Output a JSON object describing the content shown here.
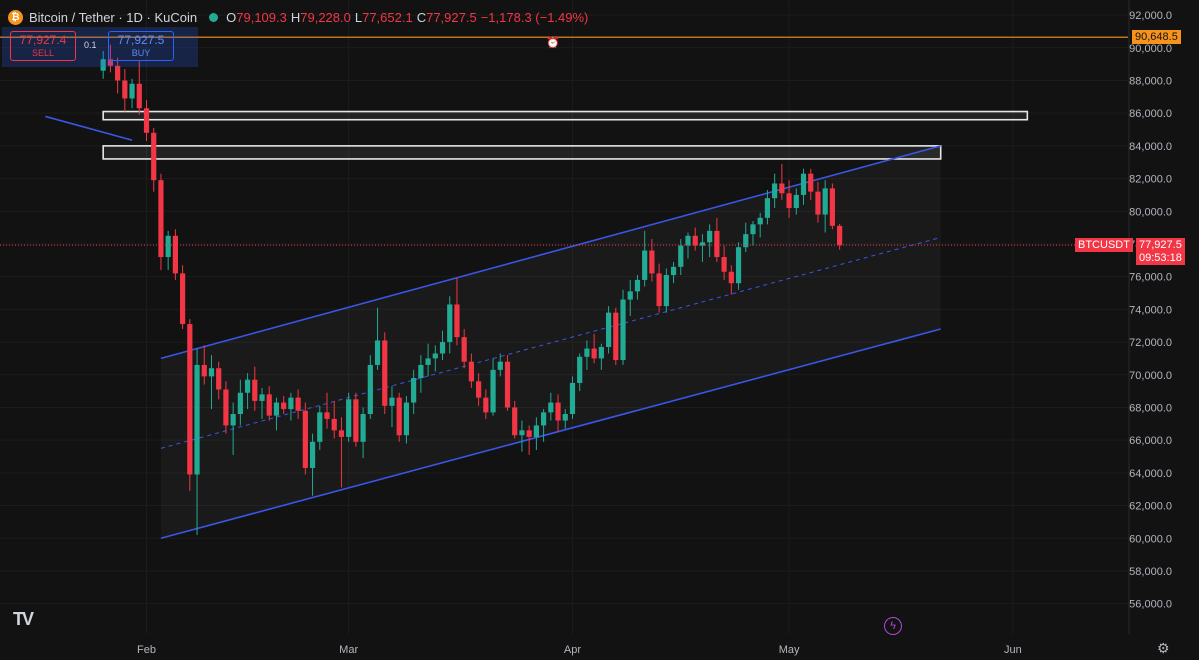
{
  "header": {
    "symbol": "Bitcoin / Tether · 1D · KuCoin",
    "coin_glyph": "₿",
    "o_label": "O",
    "o_value": "79,109.3",
    "h_label": "H",
    "h_value": "79,228.0",
    "l_label": "L",
    "l_value": "77,652.1",
    "c_label": "C",
    "c_value": "77,927.5",
    "change": "−1,178.3 (−1.49%)"
  },
  "trade": {
    "sell_price": "77,927.4",
    "sell_label": "SELL",
    "buy_price": "77,927.5",
    "buy_label": "BUY",
    "spread": "0.1"
  },
  "price_tags": {
    "level_value": "90,648.5",
    "symbol_tag": "BTCUSDT",
    "last_price": "77,927.5",
    "countdown": "09:53:18"
  },
  "icons": {
    "logo": "tradingview-logo-icon",
    "lightning": "lightning-icon",
    "settings": "gear-icon",
    "alarm": "alarm-icon"
  },
  "colors": {
    "up": "#22ab94",
    "down": "#f23645",
    "channel": "#3a56e8",
    "level_line": "#f7931a",
    "background": "#121212"
  },
  "chart_data": {
    "type": "candlestick",
    "symbol": "BTCUSDT",
    "interval": "1D",
    "ylim": [
      55000,
      92800
    ],
    "y_ticks": [
      "56,000.0",
      "58,000.0",
      "60,000.0",
      "62,000.0",
      "64,000.0",
      "66,000.0",
      "68,000.0",
      "70,000.0",
      "72,000.0",
      "74,000.0",
      "76,000.0",
      "78,000.0",
      "80,000.0",
      "82,000.0",
      "84,000.0",
      "86,000.0",
      "88,000.0",
      "90,000.0",
      "92,000.0"
    ],
    "x_ticks": [
      {
        "label": "Feb",
        "day": 0
      },
      {
        "label": "Mar",
        "day": 28
      },
      {
        "label": "Apr",
        "day": 59
      },
      {
        "label": "May",
        "day": 89
      },
      {
        "label": "Jun",
        "day": 120
      }
    ],
    "first_candle_day": -6,
    "last_price": 77927.5,
    "horizontal_level": 90648.5,
    "candles": [
      [
        88600,
        89800,
        88100,
        89300
      ],
      [
        89300,
        90200,
        88500,
        88900
      ],
      [
        88900,
        89400,
        87200,
        88000
      ],
      [
        88000,
        88700,
        86100,
        86900
      ],
      [
        86900,
        88100,
        86300,
        87800
      ],
      [
        87800,
        89200,
        85900,
        86300
      ],
      [
        86300,
        86800,
        84300,
        84800
      ],
      [
        84800,
        85100,
        81200,
        81900
      ],
      [
        81900,
        82300,
        76400,
        77200
      ],
      [
        77200,
        78800,
        76400,
        78500
      ],
      [
        78500,
        78900,
        75800,
        76200
      ],
      [
        76200,
        76700,
        72800,
        73100
      ],
      [
        73100,
        73400,
        62900,
        63900
      ],
      [
        63900,
        71600,
        60200,
        70600
      ],
      [
        70600,
        71800,
        69400,
        69900
      ],
      [
        69900,
        71200,
        67900,
        70400
      ],
      [
        70400,
        70800,
        68500,
        69100
      ],
      [
        69100,
        69600,
        66400,
        66900
      ],
      [
        66900,
        68300,
        65100,
        67600
      ],
      [
        67600,
        69700,
        66900,
        68900
      ],
      [
        68900,
        70100,
        67900,
        69700
      ],
      [
        69700,
        70500,
        67800,
        68400
      ],
      [
        68400,
        69200,
        67300,
        68800
      ],
      [
        68800,
        69300,
        67200,
        67500
      ],
      [
        67500,
        68600,
        66600,
        68300
      ],
      [
        68300,
        68700,
        67600,
        67900
      ],
      [
        67900,
        68900,
        67200,
        68600
      ],
      [
        68600,
        69100,
        67300,
        67800
      ],
      [
        67800,
        68300,
        63900,
        64300
      ],
      [
        64300,
        66400,
        62600,
        65900
      ],
      [
        65900,
        68100,
        65400,
        67700
      ],
      [
        67700,
        68900,
        66700,
        67300
      ],
      [
        67300,
        68400,
        66100,
        66600
      ],
      [
        66600,
        67400,
        63100,
        66200
      ],
      [
        66200,
        68900,
        65900,
        68500
      ],
      [
        68500,
        68900,
        65600,
        65900
      ],
      [
        65900,
        68000,
        64900,
        67600
      ],
      [
        67600,
        71200,
        67300,
        70600
      ],
      [
        70600,
        74100,
        70300,
        72100
      ],
      [
        72100,
        72600,
        67600,
        68100
      ],
      [
        68100,
        69300,
        66800,
        68600
      ],
      [
        68600,
        68900,
        65900,
        66300
      ],
      [
        66300,
        68700,
        65800,
        68300
      ],
      [
        68300,
        70300,
        67600,
        69800
      ],
      [
        69800,
        71200,
        68900,
        70600
      ],
      [
        70600,
        71900,
        69900,
        71000
      ],
      [
        71000,
        71800,
        70200,
        71300
      ],
      [
        71300,
        72700,
        70900,
        72000
      ],
      [
        72000,
        74800,
        71300,
        74300
      ],
      [
        74300,
        75900,
        71800,
        72300
      ],
      [
        72300,
        72800,
        70400,
        70800
      ],
      [
        70800,
        71300,
        69200,
        69600
      ],
      [
        69600,
        70100,
        68100,
        68600
      ],
      [
        68600,
        69100,
        67300,
        67700
      ],
      [
        67700,
        71000,
        67500,
        70300
      ],
      [
        70300,
        71300,
        69900,
        70800
      ],
      [
        70800,
        71200,
        67800,
        68000
      ],
      [
        68000,
        68400,
        66100,
        66300
      ],
      [
        66300,
        67200,
        65300,
        66600
      ],
      [
        66600,
        66900,
        65100,
        66200
      ],
      [
        66200,
        67400,
        65400,
        66900
      ],
      [
        66900,
        67900,
        65900,
        67700
      ],
      [
        67700,
        68900,
        67200,
        68300
      ],
      [
        68300,
        68800,
        66500,
        67200
      ],
      [
        67200,
        67900,
        66700,
        67600
      ],
      [
        67600,
        69900,
        67300,
        69500
      ],
      [
        69500,
        71300,
        69000,
        71100
      ],
      [
        71100,
        72100,
        70300,
        71600
      ],
      [
        71600,
        72500,
        70700,
        71000
      ],
      [
        71000,
        71900,
        70300,
        71700
      ],
      [
        71700,
        74200,
        71300,
        73800
      ],
      [
        73800,
        74100,
        70600,
        70900
      ],
      [
        70900,
        75200,
        70600,
        74600
      ],
      [
        74600,
        75800,
        73600,
        75100
      ],
      [
        75100,
        76100,
        74600,
        75800
      ],
      [
        75800,
        78800,
        75400,
        77600
      ],
      [
        77600,
        78300,
        75700,
        76200
      ],
      [
        76200,
        76800,
        73800,
        74200
      ],
      [
        74200,
        76500,
        73800,
        76100
      ],
      [
        76100,
        76900,
        75600,
        76600
      ],
      [
        76600,
        78300,
        76100,
        77900
      ],
      [
        77900,
        78700,
        77100,
        78500
      ],
      [
        78500,
        79000,
        77600,
        77900
      ],
      [
        77900,
        78600,
        76900,
        78100
      ],
      [
        78100,
        79200,
        77200,
        78800
      ],
      [
        78800,
        79600,
        76900,
        77200
      ],
      [
        77200,
        77900,
        75800,
        76300
      ],
      [
        76300,
        76700,
        74900,
        75600
      ],
      [
        75600,
        78100,
        75200,
        77800
      ],
      [
        77800,
        79300,
        77500,
        78600
      ],
      [
        78600,
        79400,
        77900,
        79200
      ],
      [
        79200,
        79900,
        78400,
        79600
      ],
      [
        79600,
        81300,
        79200,
        80800
      ],
      [
        80800,
        82300,
        80200,
        81700
      ],
      [
        81700,
        82900,
        80700,
        81100
      ],
      [
        81100,
        81900,
        79600,
        80200
      ],
      [
        80200,
        81400,
        79800,
        81000
      ],
      [
        81000,
        82600,
        80400,
        82300
      ],
      [
        82300,
        82600,
        80700,
        81200
      ],
      [
        81200,
        81800,
        79300,
        79800
      ],
      [
        79800,
        81900,
        78700,
        81400
      ],
      [
        81400,
        81700,
        78900,
        79109.3
      ],
      [
        79109.3,
        79228.0,
        77652.1,
        77927.5
      ]
    ],
    "channel_upper": [
      [
        -14,
        85800
      ],
      [
        2,
        71000
      ],
      [
        110,
        84000
      ]
    ],
    "channel_lower": [
      [
        2,
        60000
      ],
      [
        110,
        72800
      ]
    ],
    "channel_mid": [
      [
        2,
        65500
      ],
      [
        110,
        78400
      ]
    ],
    "zones": [
      {
        "top": 86100,
        "bottom": 85600,
        "from_day": -6,
        "to_day": 122
      },
      {
        "top": 84000,
        "bottom": 83200,
        "from_day": -6,
        "to_day": 110
      }
    ]
  }
}
